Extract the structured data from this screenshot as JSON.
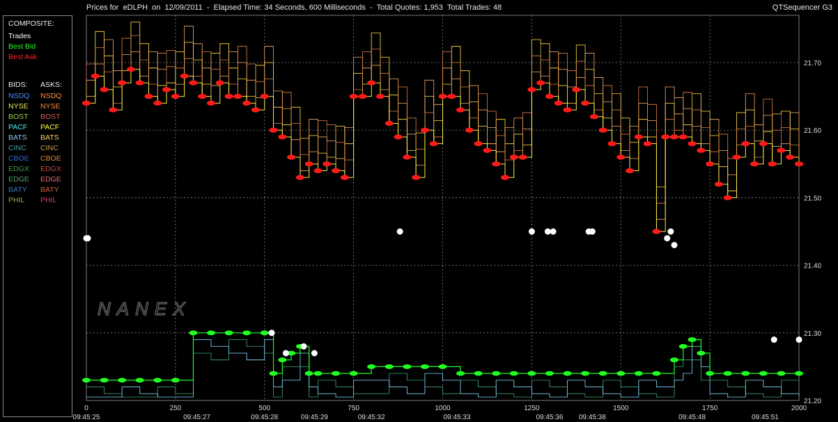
{
  "header": {
    "title": "Prices for  eDLPH  on  12/09/2011  -  Elapsed Time: 34 Seconds, 600 Milliseconds  -  Total Quotes: 1,953  Total Trades: 48",
    "app": "QTSequencer G3"
  },
  "legend": {
    "composite_heading": "COMPOSITE:",
    "composite": [
      {
        "label": "Trades",
        "color": "#ffffff"
      },
      {
        "label": "Best Bid",
        "color": "#22ff22"
      },
      {
        "label": "Best Ask",
        "color": "#ff2222"
      }
    ],
    "bids_heading": "BIDS:",
    "asks_heading": "ASKS:",
    "exchanges": [
      {
        "bid": "NSDQ",
        "ask": "NSDQ",
        "bid_color": "#4f8fff",
        "ask_color": "#ff8c3a"
      },
      {
        "bid": "NYSE",
        "ask": "NYSE",
        "bid_color": "#e8e85a",
        "ask_color": "#ff8c3a"
      },
      {
        "bid": "BOST",
        "ask": "BOST",
        "bid_color": "#9ad84a",
        "ask_color": "#e05a5a"
      },
      {
        "bid": "PACF",
        "ask": "PACF",
        "bid_color": "#4ff0e8",
        "ask_color": "#ffff40"
      },
      {
        "bid": "BATS",
        "ask": "BATS",
        "bid_color": "#8ec8ff",
        "ask_color": "#ffd060"
      },
      {
        "bid": "CINC",
        "ask": "CINC",
        "bid_color": "#3aa8a8",
        "ask_color": "#c8a040"
      },
      {
        "bid": "CBOE",
        "ask": "CBOE",
        "bid_color": "#2a6ad8",
        "ask_color": "#d88a3a"
      },
      {
        "bid": "EDGX",
        "ask": "EDGX",
        "bid_color": "#3aa040",
        "ask_color": "#c84a4a"
      },
      {
        "bid": "EDGE",
        "ask": "EDGE",
        "bid_color": "#5aa86a",
        "ask_color": "#e87070"
      },
      {
        "bid": "BATY",
        "ask": "BATY",
        "bid_color": "#3a78c8",
        "ask_color": "#d8603a"
      },
      {
        "bid": "PHIL",
        "ask": "PHIL",
        "bid_color": "#88b058",
        "ask_color": "#c0408a"
      }
    ]
  },
  "watermark": "NANEX",
  "chart_data": {
    "type": "scatter",
    "xlim": [
      0,
      2000
    ],
    "ylim": [
      21.2,
      21.77
    ],
    "x_ticks": [
      0,
      250,
      500,
      750,
      1000,
      1250,
      1500,
      1750,
      2000
    ],
    "y_ticks": [
      21.2,
      21.3,
      21.4,
      21.5,
      21.6,
      21.7
    ],
    "y_tick_labels": [
      "21.20",
      "21.30",
      "21.40",
      "21.50",
      "21.60",
      "21.70"
    ],
    "time_labels": [
      {
        "x": 0,
        "label": "09:45:25"
      },
      {
        "x": 310,
        "label": "09:45:27"
      },
      {
        "x": 500,
        "label": "09:45:28"
      },
      {
        "x": 640,
        "label": "09:45:29"
      },
      {
        "x": 800,
        "label": "09:45:32"
      },
      {
        "x": 1040,
        "label": "09:45:33"
      },
      {
        "x": 1300,
        "label": "09:45:36"
      },
      {
        "x": 1420,
        "label": "09:45:38"
      },
      {
        "x": 1700,
        "label": "09:45:48"
      },
      {
        "x": 1905,
        "label": "09:45:51"
      }
    ],
    "grid": true,
    "series": [
      {
        "name": "Best Ask",
        "color": "#ff1a1a",
        "x": [
          0,
          25,
          50,
          75,
          100,
          125,
          150,
          175,
          200,
          225,
          250,
          275,
          300,
          325,
          350,
          375,
          400,
          425,
          450,
          475,
          500,
          525,
          550,
          575,
          600,
          625,
          650,
          675,
          700,
          725,
          750,
          775,
          800,
          825,
          850,
          875,
          900,
          925,
          950,
          975,
          1000,
          1025,
          1050,
          1075,
          1100,
          1125,
          1150,
          1175,
          1200,
          1225,
          1250,
          1275,
          1300,
          1325,
          1350,
          1375,
          1400,
          1425,
          1450,
          1475,
          1500,
          1525,
          1550,
          1575,
          1600,
          1625,
          1650,
          1675,
          1700,
          1725,
          1750,
          1775,
          1800,
          1825,
          1850,
          1875,
          1900,
          1925,
          1950,
          1975,
          2000
        ],
        "y": [
          21.64,
          21.68,
          21.66,
          21.63,
          21.67,
          21.69,
          21.67,
          21.65,
          21.64,
          21.66,
          21.65,
          21.68,
          21.67,
          21.65,
          21.64,
          21.67,
          21.65,
          21.65,
          21.64,
          21.63,
          21.65,
          21.6,
          21.59,
          21.56,
          21.53,
          21.55,
          21.54,
          21.55,
          21.54,
          21.53,
          21.65,
          21.65,
          21.67,
          21.65,
          21.61,
          21.59,
          21.56,
          21.53,
          21.6,
          21.58,
          21.65,
          21.65,
          21.63,
          21.6,
          21.58,
          21.57,
          21.55,
          21.53,
          21.56,
          21.56,
          21.66,
          21.67,
          21.65,
          21.64,
          21.63,
          21.66,
          21.64,
          21.62,
          21.6,
          21.58,
          21.56,
          21.54,
          21.59,
          21.58,
          21.45,
          21.59,
          21.59,
          21.59,
          21.58,
          21.57,
          21.55,
          21.52,
          21.5,
          21.56,
          21.58,
          21.55,
          21.58,
          21.55,
          21.57,
          21.56,
          21.55
        ]
      },
      {
        "name": "Best Bid",
        "color": "#22ff22",
        "x": [
          0,
          50,
          100,
          150,
          200,
          250,
          300,
          350,
          400,
          450,
          500,
          525,
          550,
          575,
          600,
          625,
          650,
          700,
          750,
          800,
          850,
          900,
          950,
          1000,
          1050,
          1100,
          1150,
          1200,
          1250,
          1300,
          1350,
          1400,
          1450,
          1500,
          1550,
          1600,
          1650,
          1675,
          1700,
          1725,
          1750,
          1800,
          1850,
          1900,
          1950,
          2000
        ],
        "y": [
          21.23,
          21.23,
          21.23,
          21.23,
          21.23,
          21.23,
          21.3,
          21.3,
          21.3,
          21.3,
          21.3,
          21.24,
          21.26,
          21.27,
          21.28,
          21.24,
          21.24,
          21.24,
          21.24,
          21.25,
          21.25,
          21.25,
          21.25,
          21.25,
          21.24,
          21.24,
          21.24,
          21.24,
          21.24,
          21.24,
          21.24,
          21.24,
          21.24,
          21.24,
          21.24,
          21.24,
          21.26,
          21.28,
          21.29,
          21.27,
          21.24,
          21.24,
          21.24,
          21.24,
          21.24,
          21.24
        ]
      },
      {
        "name": "Trades",
        "color": "#ffffff",
        "x": [
          0,
          4,
          880,
          1250,
          1295,
          1310,
          1410,
          1420,
          1630,
          1640,
          1650,
          520,
          560,
          610,
          640,
          1930,
          2000
        ],
        "y": [
          21.44,
          21.44,
          21.45,
          21.45,
          21.45,
          21.45,
          21.45,
          21.45,
          21.44,
          21.45,
          21.43,
          21.3,
          21.27,
          21.28,
          21.27,
          21.29,
          21.29
        ]
      }
    ]
  }
}
